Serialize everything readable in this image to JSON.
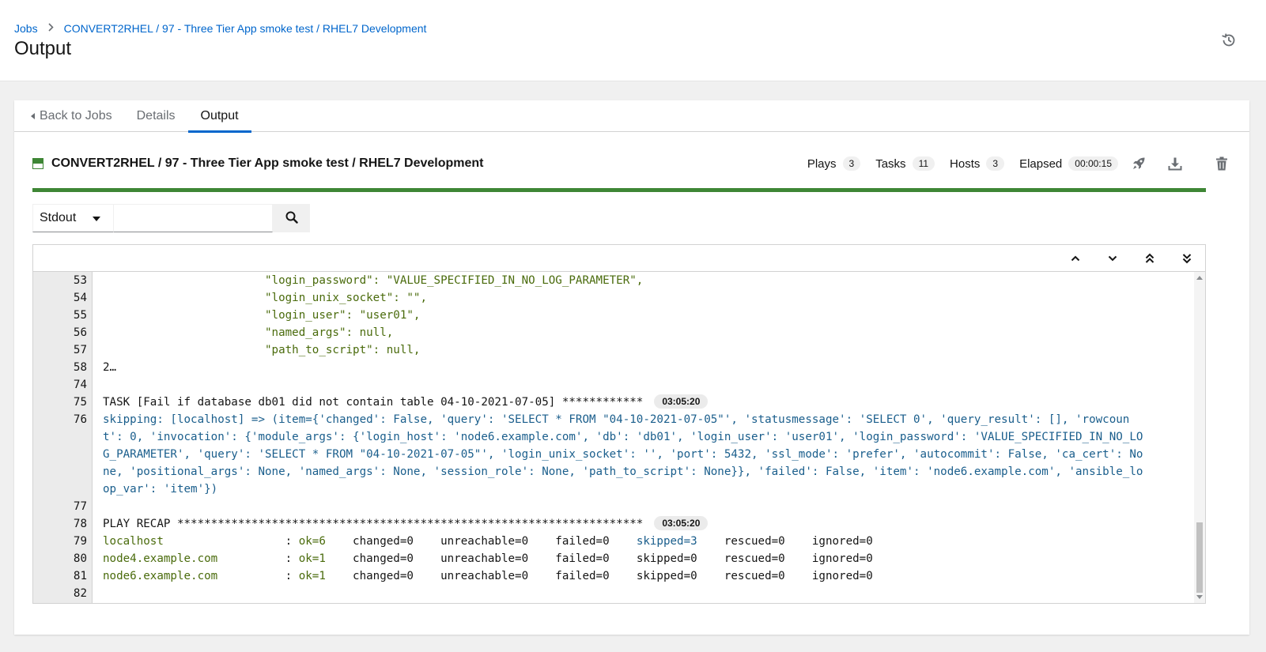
{
  "breadcrumb": {
    "jobs": "Jobs",
    "current": "CONVERT2RHEL / 97 - Three Tier App smoke test / RHEL7 Development"
  },
  "page_title": "Output",
  "tabs": {
    "back": "Back to Jobs",
    "details": "Details",
    "output": "Output"
  },
  "job": {
    "title": "CONVERT2RHEL / 97 - Three Tier App smoke test / RHEL7 Development",
    "status_color": "#3e8635",
    "plays_label": "Plays",
    "plays": "3",
    "tasks_label": "Tasks",
    "tasks": "11",
    "hosts_label": "Hosts",
    "hosts": "3",
    "elapsed_label": "Elapsed",
    "elapsed": "00:00:15",
    "progress": 1.0
  },
  "search": {
    "select_value": "Stdout",
    "input_value": ""
  },
  "icons": {
    "history": "history-icon",
    "rocket": "rocket-icon",
    "download": "download-icon",
    "delete": "trash-icon",
    "search": "search-icon",
    "up": "angle-up-icon",
    "down": "angle-down-icon",
    "top": "angle-double-up-icon",
    "bottom": "angle-double-down-icon"
  },
  "output": {
    "lines": [
      {
        "n": "53",
        "t": "                        \"login_password\": \"VALUE_SPECIFIED_IN_NO_LOG_PARAMETER\","
      },
      {
        "n": "54",
        "t": "                        \"login_unix_socket\": \"\","
      },
      {
        "n": "55",
        "t": "                        \"login_user\": \"user01\","
      },
      {
        "n": "56",
        "t": "                        \"named_args\": null,"
      },
      {
        "n": "57",
        "t": "                        \"path_to_script\": null,"
      },
      {
        "n": "58",
        "t": "2…"
      },
      {
        "n": "74",
        "t": ""
      },
      {
        "n": "75",
        "t": "TASK [Fail if database db01 did not contain table 04-10-2021-07-05] ************",
        "ts": "03:05:20"
      },
      {
        "n": "76",
        "t": "skipping: [localhost] => (item={'changed': False, 'query': 'SELECT * FROM \"04-10-2021-07-05\"', 'statusmessage': 'SELECT 0', 'query_result': [], 'rowcoun"
      },
      {
        "n": "",
        "t": "t': 0, 'invocation': {'module_args': {'login_host': 'node6.example.com', 'db': 'db01', 'login_user': 'user01', 'login_password': 'VALUE_SPECIFIED_IN_NO_LO"
      },
      {
        "n": "",
        "t": "G_PARAMETER', 'query': 'SELECT * FROM \"04-10-2021-07-05\"', 'login_unix_socket': '', 'port': 5432, 'ssl_mode': 'prefer', 'autocommit': False, 'ca_cert': No"
      },
      {
        "n": "",
        "t": "ne, 'positional_args': None, 'named_args': None, 'session_role': None, 'path_to_script': None}}, 'failed': False, 'item': 'node6.example.com', 'ansible_lo"
      },
      {
        "n": "",
        "t": "op_var': 'item'})"
      },
      {
        "n": "77",
        "t": ""
      },
      {
        "n": "78",
        "t": "PLAY RECAP *********************************************************************",
        "ts": "03:05:20"
      },
      {
        "n": "79",
        "host": "localhost                  ",
        "ok": "ok=6",
        "rest1": "    changed=0    unreachable=0    failed=0    ",
        "skipped": "skipped=3",
        "rest2": "    rescued=0    ignored=0"
      },
      {
        "n": "80",
        "host": "node4.example.com          ",
        "ok": "ok=1",
        "rest1": "    changed=0    unreachable=0    failed=0    ",
        "skipped": "skipped=0",
        "rest2": "    rescued=0    ignored=0"
      },
      {
        "n": "81",
        "host": "node6.example.com          ",
        "ok": "ok=1",
        "rest1": "    changed=0    unreachable=0    failed=0    ",
        "skipped": "skipped=0",
        "rest2": "    rescued=0    ignored=0"
      },
      {
        "n": "82",
        "t": ""
      }
    ]
  },
  "colors": {
    "link": "#0066cc",
    "success": "#3e8635",
    "ok_text": "#4a6b0c",
    "skip_text": "#1a5e8c"
  }
}
